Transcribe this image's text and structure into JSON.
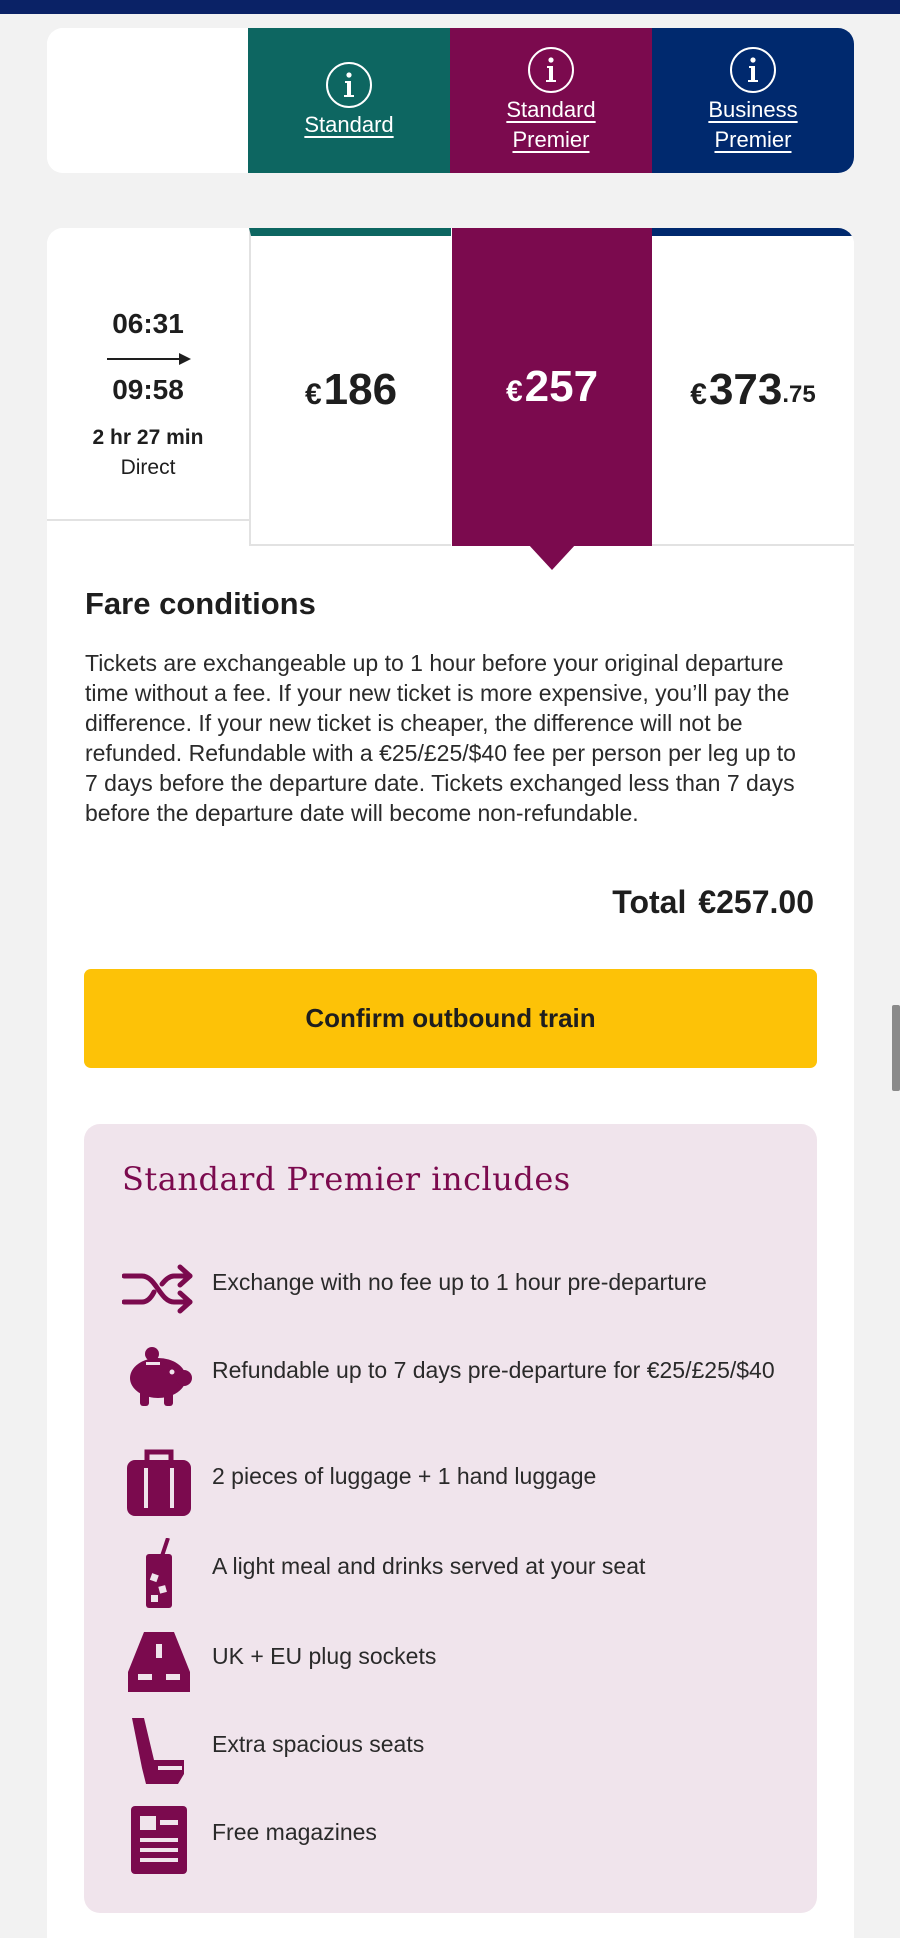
{
  "classes": [
    {
      "label_line1": "Standard",
      "label_line2": "",
      "color": "#0d6661",
      "icon": "info-icon"
    },
    {
      "label_line1": "Standard",
      "label_line2": "Premier",
      "color": "#7b0a4e",
      "icon": "info-icon"
    },
    {
      "label_line1": "Business",
      "label_line2": "Premier",
      "color": "#00296e",
      "icon": "info-icon"
    }
  ],
  "journey": {
    "departure_time": "06:31",
    "arrival_time": "09:58",
    "duration": "2 hr 27 min",
    "type": "Direct"
  },
  "prices": {
    "standard": {
      "currency": "€",
      "amount": "186",
      "decimals": ""
    },
    "standard_premier": {
      "currency": "€",
      "amount": "257",
      "decimals": ""
    },
    "business_premier": {
      "currency": "€",
      "amount": "373",
      "decimals": ".75"
    }
  },
  "fare_conditions": {
    "title": "Fare conditions",
    "text": "Tickets are exchangeable up to 1 hour before your original departure time without a fee. If your new ticket is more expensive, you’ll pay the difference. If your new ticket is cheaper, the difference will not be refunded. Refundable with a €25/£25/$40 fee per person per leg up to 7 days before the departure date. Tickets exchanged less than 7 days before the departure date will become non-refundable."
  },
  "total": {
    "label": "Total",
    "value": "€257.00"
  },
  "confirm_button": "Confirm outbound train",
  "includes": {
    "title": "Standard Premier includes",
    "accent_color": "#7b0a4e",
    "items": [
      {
        "icon": "exchange-arrows-icon",
        "text": "Exchange with no fee up to 1 hour pre-departure"
      },
      {
        "icon": "piggy-bank-icon",
        "text": "Refundable up to 7 days pre-departure for €25/£25/$40"
      },
      {
        "icon": "luggage-icon",
        "text": "2 pieces of luggage + 1 hand luggage"
      },
      {
        "icon": "drink-icon",
        "text": "A light meal and drinks served at your seat"
      },
      {
        "icon": "plug-socket-icon",
        "text": "UK + EU plug sockets"
      },
      {
        "icon": "seat-icon",
        "text": "Extra spacious seats"
      },
      {
        "icon": "magazine-icon",
        "text": "Free magazines"
      }
    ]
  }
}
